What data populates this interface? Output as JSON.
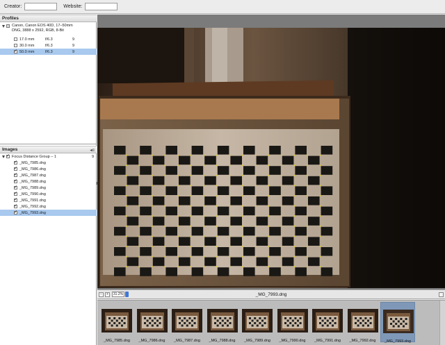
{
  "header": {
    "creator_label": "Creator:",
    "creator_value": "",
    "website_label": "Website:",
    "website_value": ""
  },
  "profiles": {
    "title": "Profiles",
    "camera_line1": "Canon, Canon EOS 40D, 17–50mm",
    "camera_line2": "DNG, 3888 x 2592, RGB, 8-Bit",
    "items": [
      {
        "focal": "17.0 mm",
        "aperture": "f/6.3",
        "count": "9",
        "checked": false
      },
      {
        "focal": "30.0 mm",
        "aperture": "f/6.3",
        "count": "9",
        "checked": false
      },
      {
        "focal": "50.0 mm",
        "aperture": "f/6.3",
        "count": "9",
        "checked": true
      }
    ]
  },
  "images": {
    "title": "Images",
    "group_name": "Focus Distance Group – 1",
    "group_count": "9",
    "files": [
      "_MG_7985.dng",
      "_MG_7986.dng",
      "_MG_7987.dng",
      "_MG_7988.dng",
      "_MG_7989.dng",
      "_MG_7990.dng",
      "_MG_7991.dng",
      "_MG_7992.dng",
      "_MG_7993.dng"
    ]
  },
  "viewer": {
    "zoom_value": "31.2%",
    "current_file": "_MG_7993.dng"
  },
  "filmstrip": {
    "thumbnails": [
      "_MG_7985.dng",
      "_MG_7986.dng",
      "_MG_7987.dng",
      "_MG_7988.dng",
      "_MG_7989.dng",
      "_MG_7990.dng",
      "_MG_7991.dng",
      "_MG_7992.dng",
      "_MG_7993.dng"
    ],
    "selected_index": 8
  }
}
